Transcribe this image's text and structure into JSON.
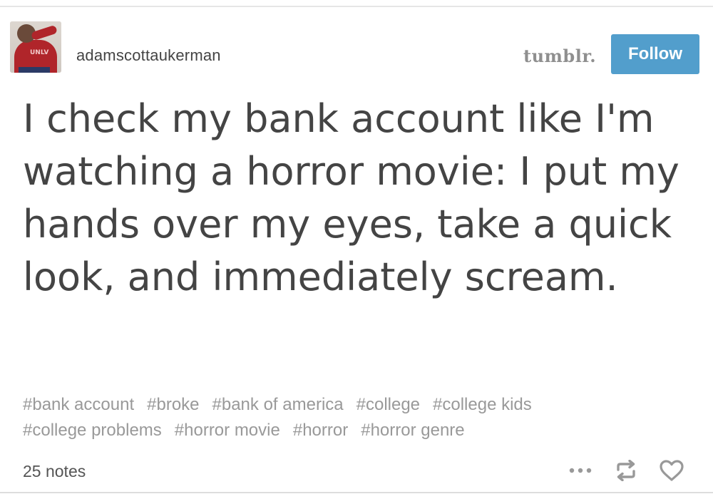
{
  "post": {
    "username": "adamscottaukerman",
    "brand": "tumblr.",
    "follow_label": "Follow",
    "text": "I check my bank account like I'm watching a horror movie: I put my hands over my eyes, take a quick look, and immediately scream.",
    "tags": [
      "#bank account",
      "#broke",
      "#bank of america",
      "#college",
      "#college kids",
      "#college problems",
      "#horror movie",
      "#horror",
      "#horror genre"
    ],
    "notes": "25 notes",
    "avatar_logo": "UNLV",
    "icons": {
      "more": "more-dots-icon",
      "reblog": "reblog-icon",
      "like": "heart-icon"
    },
    "colors": {
      "follow_bg": "#529ecc",
      "text": "#444444",
      "tag": "#999999",
      "icon": "#aaaaaa"
    }
  }
}
